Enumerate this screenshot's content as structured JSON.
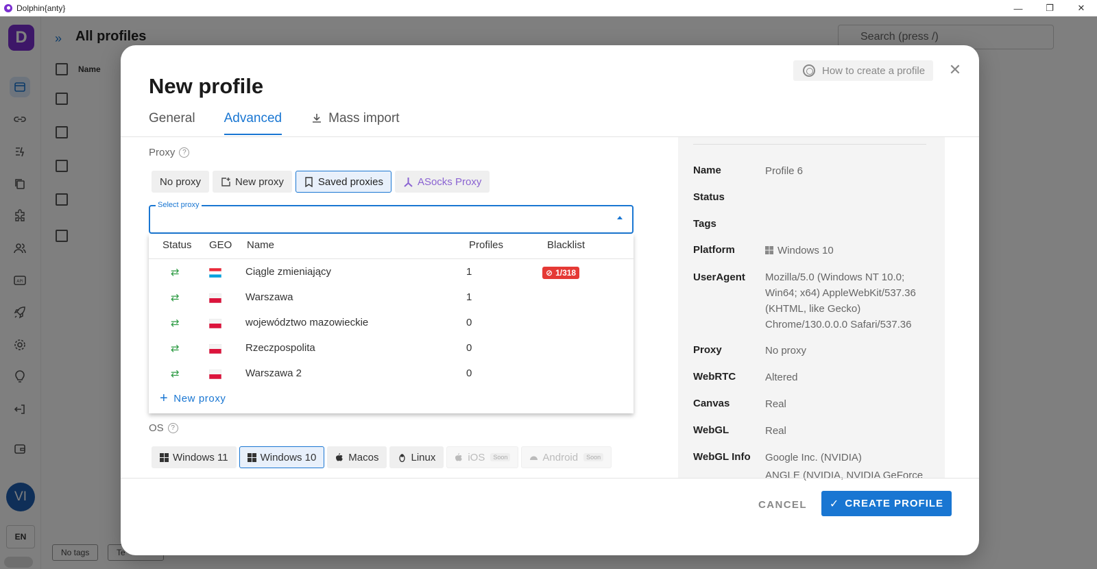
{
  "window": {
    "title": "Dolphin{anty}",
    "minimize": "—",
    "restore": "❐",
    "close": "✕"
  },
  "background": {
    "logo_letter": "D",
    "header_title": "All profiles",
    "search_placeholder": "Search (press /)",
    "col_name": "Name",
    "avatar": "VI",
    "lang": "EN",
    "footer_tags": [
      "No tags",
      "Te"
    ]
  },
  "modal": {
    "title": "New profile",
    "howto": "How to create a profile",
    "tabs": [
      {
        "label": "General"
      },
      {
        "label": "Advanced"
      },
      {
        "label": "Mass import"
      }
    ],
    "proxy": {
      "label": "Proxy",
      "buttons": [
        "No proxy",
        "New proxy",
        "Saved proxies",
        "ASocks Proxy"
      ],
      "select_label": "Select proxy",
      "columns": [
        "Status",
        "GEO",
        "Name",
        "Profiles",
        "Blacklist"
      ],
      "rows": [
        {
          "status": "⇄",
          "geo": "lu",
          "name": "Ciągle zmieniający",
          "profiles": "1",
          "blacklist": "1/318"
        },
        {
          "status": "⇄",
          "geo": "pl",
          "name": "Warszawa",
          "profiles": "1",
          "blacklist": ""
        },
        {
          "status": "⇄",
          "geo": "pl",
          "name": "województwo mazowieckie",
          "profiles": "0",
          "blacklist": ""
        },
        {
          "status": "⇄",
          "geo": "pl",
          "name": "Rzeczpospolita",
          "profiles": "0",
          "blacklist": ""
        },
        {
          "status": "⇄",
          "geo": "pl",
          "name": "Warszawa 2",
          "profiles": "0",
          "blacklist": ""
        }
      ],
      "new_proxy_link": "New proxy"
    },
    "os": {
      "label": "OS",
      "buttons": [
        "Windows 11",
        "Windows 10",
        "Macos",
        "Linux",
        "iOS",
        "Android"
      ],
      "soon": "Soon"
    },
    "summary": [
      {
        "key": "Name",
        "value": "Profile 6"
      },
      {
        "key": "Status",
        "value": ""
      },
      {
        "key": "Tags",
        "value": ""
      },
      {
        "key": "Platform",
        "value": "Windows 10"
      },
      {
        "key": "UserAgent",
        "value": "Mozilla/5.0 (Windows NT 10.0; Win64; x64) AppleWebKit/537.36 (KHTML, like Gecko) Chrome/130.0.0.0 Safari/537.36"
      },
      {
        "key": "Proxy",
        "value": "No proxy"
      },
      {
        "key": "WebRTC",
        "value": "Altered"
      },
      {
        "key": "Canvas",
        "value": "Real"
      },
      {
        "key": "WebGL",
        "value": "Real"
      },
      {
        "key": "WebGL Info",
        "value": "Google Inc. (NVIDIA)"
      },
      {
        "key": "",
        "value": "ANGLE (NVIDIA, NVIDIA GeForce"
      }
    ],
    "cancel": "CANCEL",
    "create": "CREATE PROFILE"
  },
  "colors": {
    "accent": "#1976d2",
    "brand": "#7b2fd0",
    "danger": "#e53935",
    "online": "#2e9b44"
  }
}
